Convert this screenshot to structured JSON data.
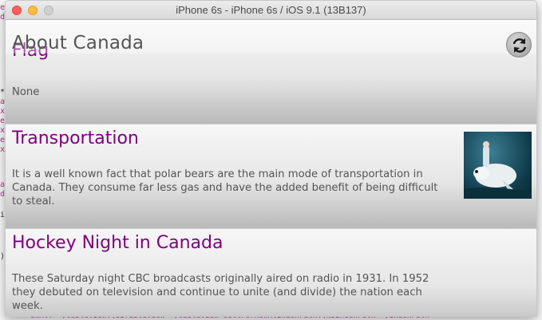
{
  "window": {
    "title": "iPhone 6s - iPhone 6s / iOS 9.1 (13B137)"
  },
  "nav": {
    "title": "About Canada",
    "refresh_icon": "refresh-icon"
  },
  "cells": [
    {
      "title": "Flag",
      "body": "None"
    },
    {
      "title": "Transportation",
      "body": "It is a well known fact that polar bears are the main mode of transportation in Canada. They consume far less gas and have the added benefit of being difficult to steal.",
      "image": "polar-bear-rider-image"
    },
    {
      "title": "Hockey Night in Canada",
      "body": "These Saturday night CBC broadcasts originally aired on radio in 1931. In 1952 they debuted on television and continue to unite (and divide) the nation each week."
    }
  ],
  "background_code": {
    "bottom_line": "ewAt: *)tableView:(UITableView *)tableView cellForRowAtIndexPath:(NSIndexPath *)indexPath"
  },
  "colors": {
    "title_purple": "#800080",
    "body_gray": "#555555"
  }
}
